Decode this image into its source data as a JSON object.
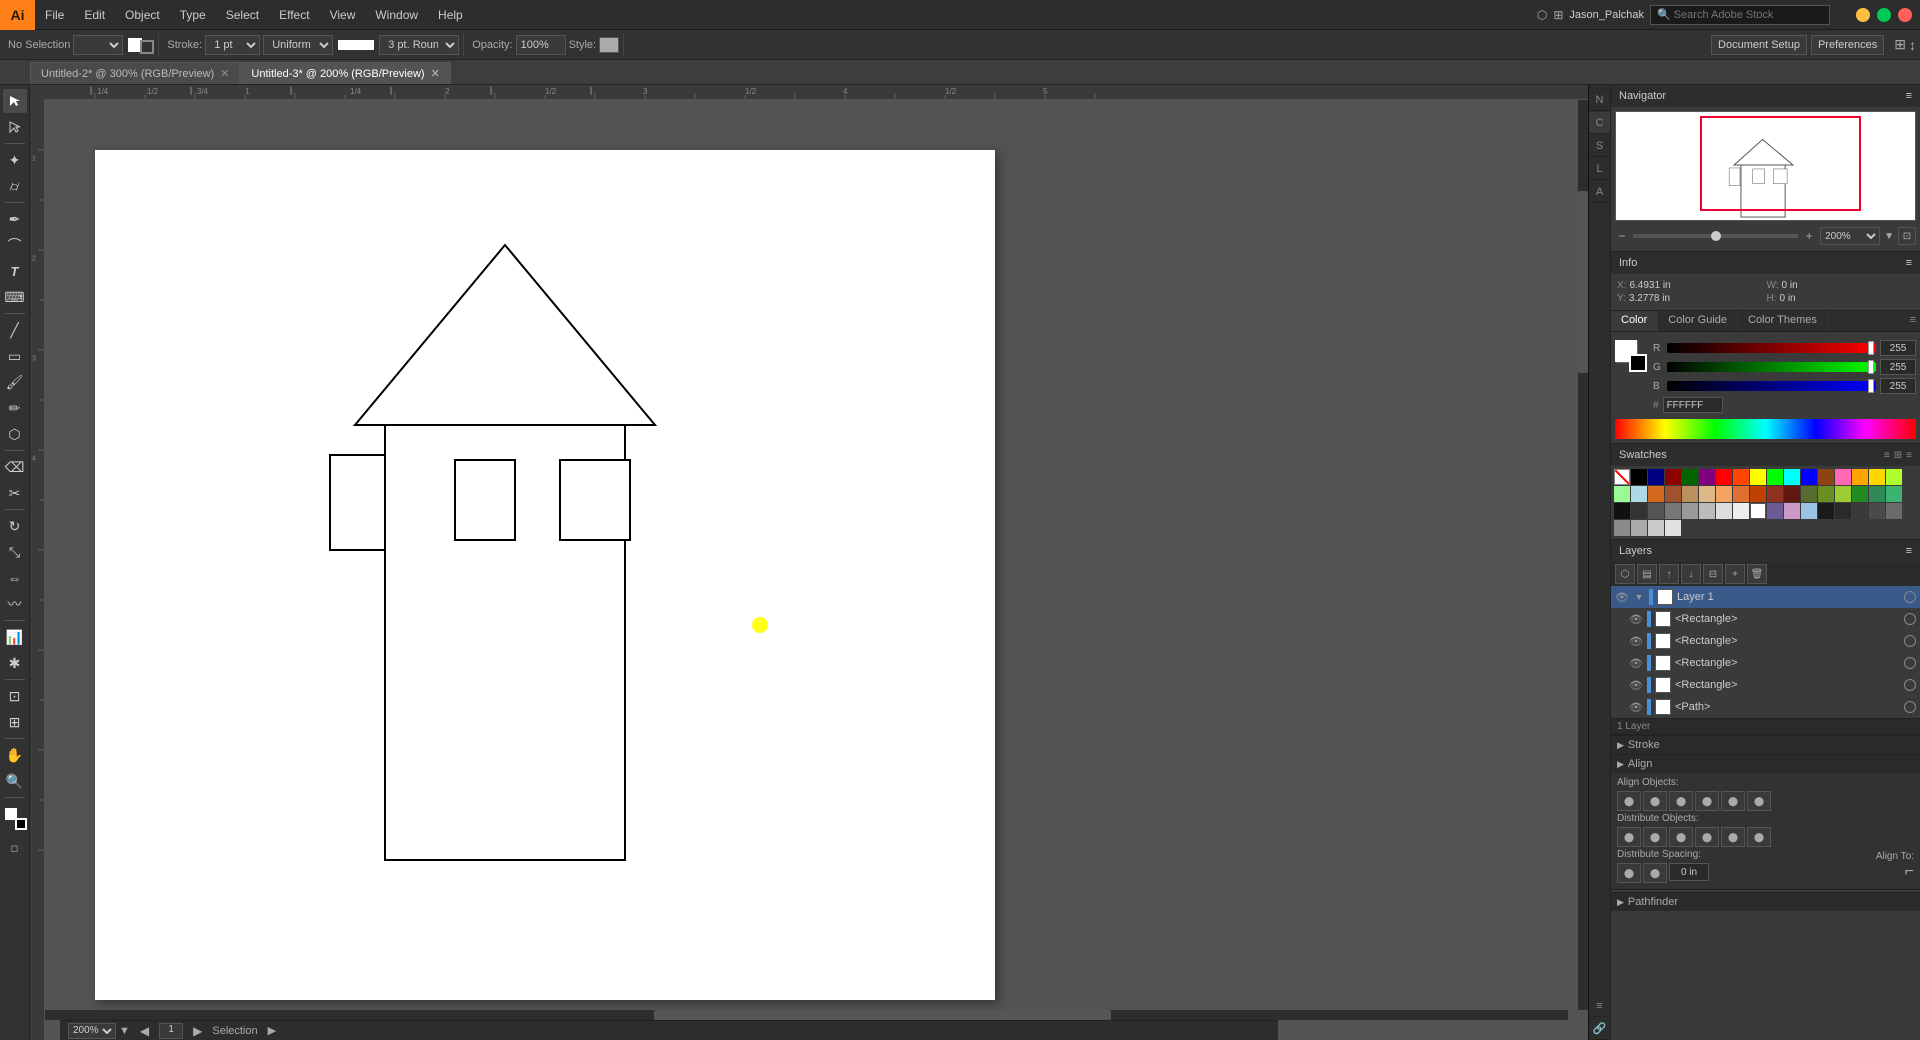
{
  "app": {
    "logo": "Ai",
    "logo_bg": "#FF7F18"
  },
  "menu": {
    "items": [
      "File",
      "Edit",
      "Object",
      "Type",
      "Select",
      "Effect",
      "View",
      "Window",
      "Help"
    ]
  },
  "window_controls": {
    "minimize": "—",
    "maximize": "⬜",
    "close": "✕"
  },
  "user": {
    "name": "Jason_Palchak",
    "search_placeholder": "Search Adobe Stock"
  },
  "top_menu_extra": {
    "menu1": "",
    "menu2": ""
  },
  "toolbar": {
    "no_selection_label": "No Selection",
    "stroke_label": "Stroke:",
    "stroke_weight": "1 pt",
    "stroke_type": "Uniform",
    "corner_label": "3 pt. Round",
    "opacity_label": "Opacity:",
    "opacity_value": "100%",
    "style_label": "Style:",
    "document_setup_btn": "Document Setup",
    "preferences_btn": "Preferences"
  },
  "tabs": [
    {
      "label": "Untitled-2* @ 300% (RGB/Preview)",
      "active": false
    },
    {
      "label": "Untitled-3* @ 200% (RGB/Preview)",
      "active": true
    }
  ],
  "navigator": {
    "title": "Navigator",
    "zoom_value": "200%"
  },
  "info": {
    "title": "Info",
    "x_label": "X:",
    "x_value": "6.4931 in",
    "y_label": "Y:",
    "y_value": "3.2778 in",
    "w_label": "W:",
    "w_value": "0 in",
    "h_label": "H:",
    "h_value": "0 in"
  },
  "color": {
    "title": "Color",
    "tabs": [
      "Color",
      "Color Guide",
      "Color Themes"
    ],
    "r_label": "R",
    "r_value": "255",
    "g_label": "G",
    "g_value": "255",
    "b_label": "B",
    "b_value": "255",
    "hex_value": "FFFFFF"
  },
  "swatches": {
    "title": "Swatches"
  },
  "layers": {
    "title": "Layers",
    "items": [
      {
        "name": "Layer 1",
        "type": "layer",
        "visible": true,
        "expanded": true
      },
      {
        "name": "<Rectangle>",
        "type": "object",
        "visible": true
      },
      {
        "name": "<Rectangle>",
        "type": "object",
        "visible": true
      },
      {
        "name": "<Rectangle>",
        "type": "object",
        "visible": true
      },
      {
        "name": "<Rectangle>",
        "type": "object",
        "visible": true
      },
      {
        "name": "<Path>",
        "type": "object",
        "visible": true
      }
    ],
    "layer_count": "1 Layer"
  },
  "align": {
    "title": "Align",
    "align_objects_label": "Align Objects:",
    "distribute_objects_label": "Distribute Objects:",
    "distribute_spacing_label": "Distribute Spacing:",
    "align_to_label": "Align To:"
  },
  "stroke": {
    "title": "Stroke"
  },
  "status_bar": {
    "zoom_value": "200%",
    "selection_label": "Selection",
    "artboard_label": "1 Layer"
  },
  "canvas": {
    "background": "white"
  }
}
